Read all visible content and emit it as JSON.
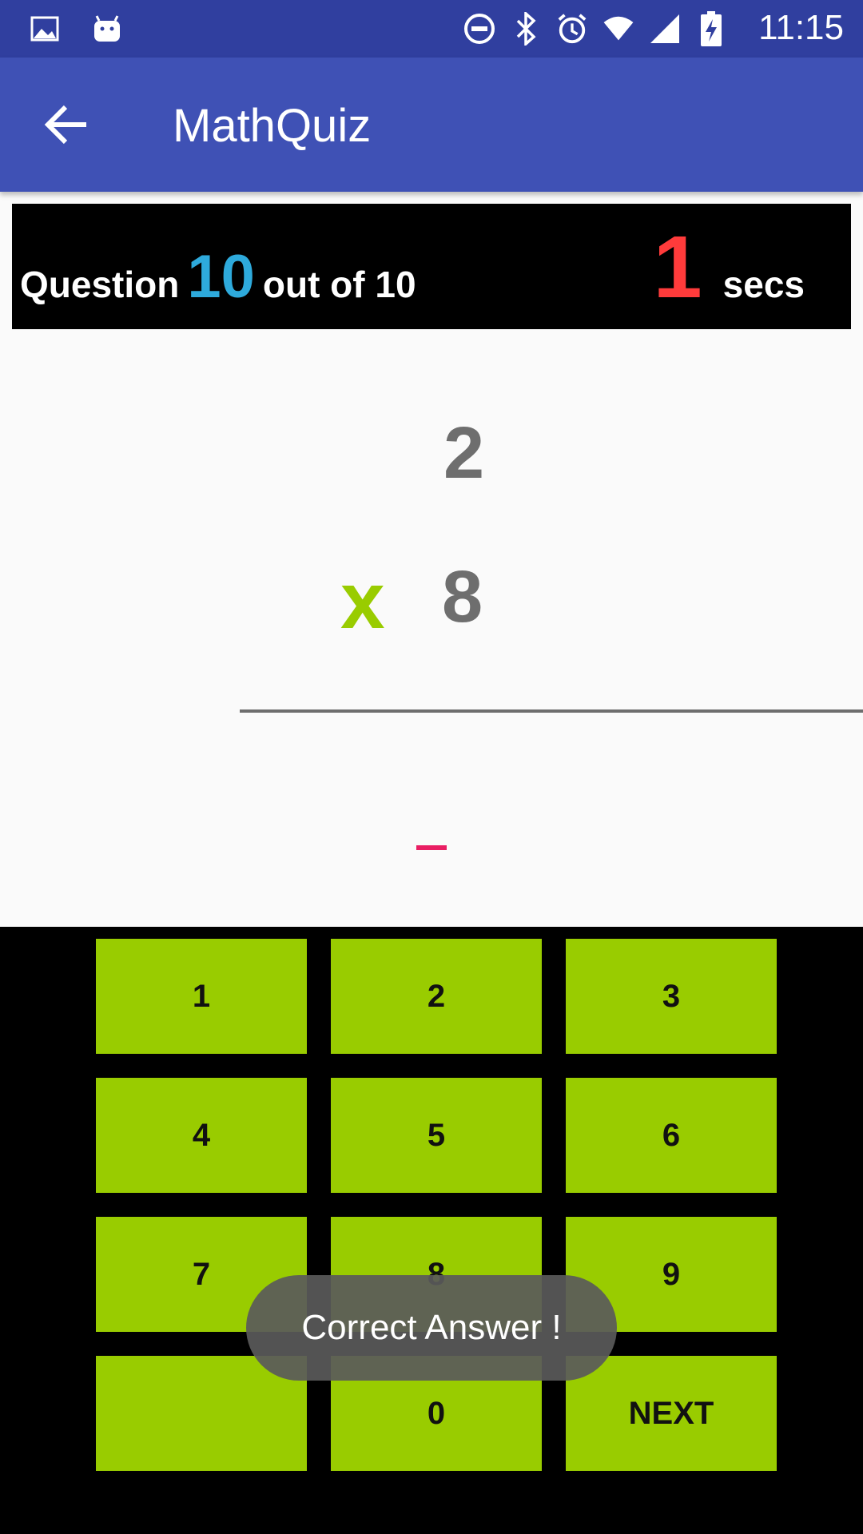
{
  "status_bar": {
    "left_icons": [
      "image-icon",
      "android-icon"
    ],
    "right_icons": [
      "do-not-disturb-icon",
      "bluetooth-icon",
      "alarm-icon",
      "wifi-icon",
      "cell-signal-icon",
      "battery-charging-icon"
    ],
    "time": "11:15"
  },
  "app_bar": {
    "title": "MathQuiz",
    "back_icon": "back-arrow-icon"
  },
  "quiz_header": {
    "question_word": "Question",
    "current": "10",
    "out_of_text": "out of 10",
    "timer_value": "1",
    "timer_unit": "secs"
  },
  "problem": {
    "operand1": "2",
    "operator": "x",
    "operand2": "8",
    "answer": ""
  },
  "keypad": {
    "keys": [
      "1",
      "2",
      "3",
      "4",
      "5",
      "6",
      "7",
      "8",
      "9",
      "",
      "0",
      "NEXT"
    ]
  },
  "toast": {
    "message": "Correct Answer !"
  },
  "colors": {
    "status_bar": "#303f9f",
    "app_bar": "#3f51b5",
    "key_green": "#99cc00",
    "question_number": "#2eaadc",
    "timer": "#ff3b3b",
    "cursor": "#e91e63"
  }
}
